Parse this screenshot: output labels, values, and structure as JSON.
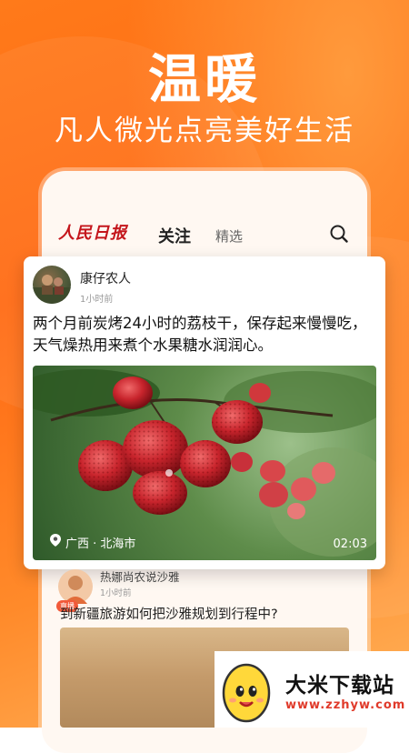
{
  "hero": {
    "title": "温暖",
    "subtitle": "凡人微光点亮美好生活"
  },
  "app": {
    "logo_text": "人民日报",
    "tabs": [
      {
        "label": "关注",
        "active": true
      },
      {
        "label": "精选",
        "active": false
      }
    ]
  },
  "post": {
    "author": "康仔农人",
    "time": "1小时前",
    "text": "两个月前炭烤24小时的荔枝干，保存起来慢慢吃，天气燥热用来煮个水果糖水润润心。",
    "location": "广西 · 北海市",
    "duration": "02:03"
  },
  "post2": {
    "author": "热娜尚农说沙雅",
    "badge": "直播",
    "time": "1小时前",
    "text": "到新疆旅游如何把沙雅规划到行程中?"
  },
  "watermark": {
    "name": "大米下载站",
    "url": "www.zzhyw.com"
  },
  "colors": {
    "brand_orange": "#ff6a13",
    "logo_red": "#c4161c"
  }
}
